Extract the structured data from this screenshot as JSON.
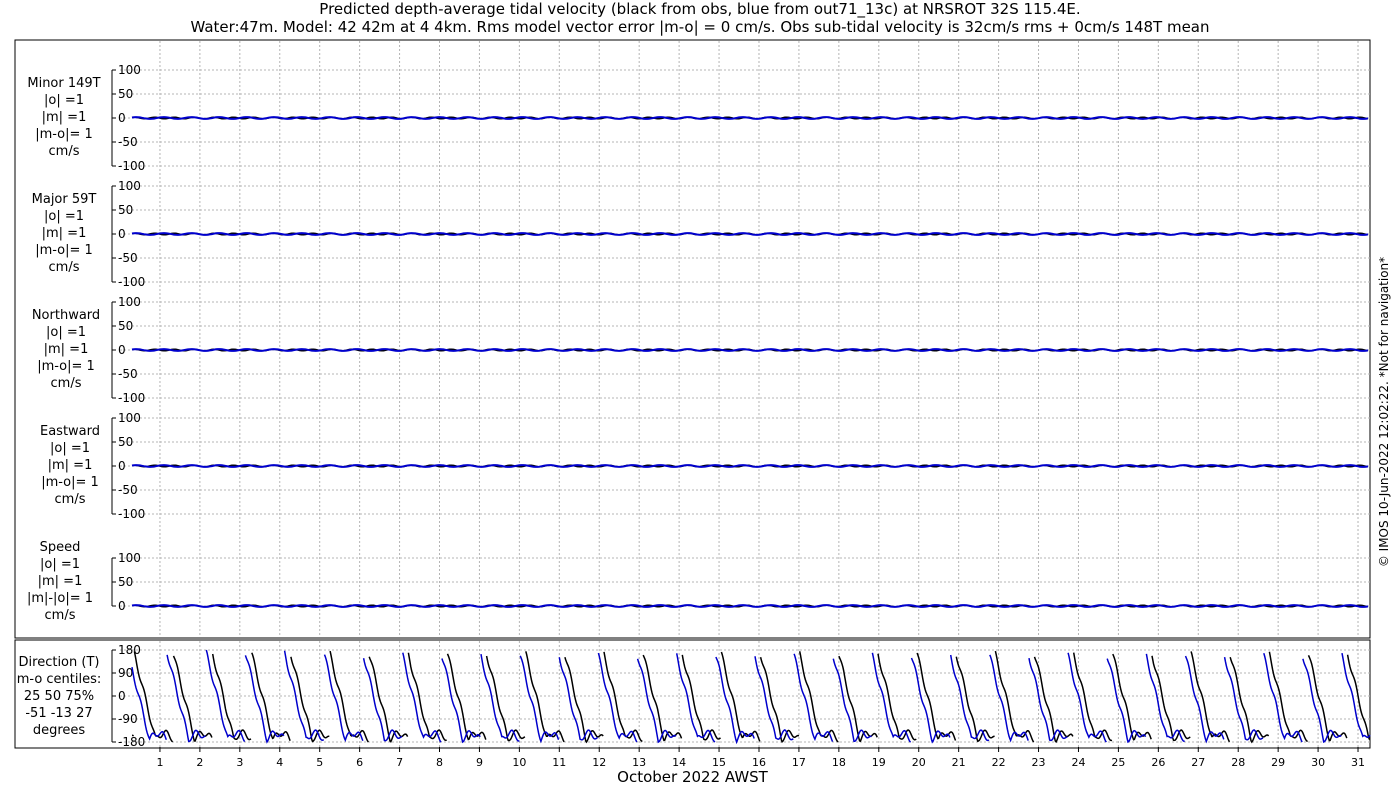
{
  "title": {
    "line1": "Predicted depth-average tidal velocity (black from obs, blue from out71_13c) at NRSROT 32S 115.4E.",
    "line2": "Water:47m. Model: 42 42m at 4 4km. Rms model vector error |m-o| = 0 cm/s. Obs sub-tidal velocity is 32cm/s rms + 0cm/s 148T mean"
  },
  "xlabel": "October 2022 AWST",
  "credit": "© IMOS 10-Jun-2022 12:02:22. *Not for navigation*",
  "panels": [
    {
      "lines": [
        "Minor 149T",
        "|o| =1",
        "|m| =1",
        "|m-o|= 1",
        "cm/s"
      ]
    },
    {
      "lines": [
        "Major 59T",
        "|o| =1",
        "|m| =1",
        "|m-o|= 1",
        "cm/s"
      ]
    },
    {
      "lines": [
        "Northward",
        "|o| =1",
        "|m| =1",
        "|m-o|= 1",
        "cm/s"
      ]
    },
    {
      "lines": [
        "Eastward",
        "|o| =1",
        "|m| =1",
        "|m-o|= 1",
        "cm/s"
      ]
    },
    {
      "lines": [
        "Speed",
        "|o| =1",
        "|m| =1",
        "|m|-|o|= 1",
        "cm/s"
      ]
    },
    {
      "lines": [
        "Direction (T)",
        "m-o centiles:",
        "25  50  75%",
        "-51 -13  27",
        "degrees"
      ]
    }
  ],
  "chart_data": {
    "type": "line",
    "x_range_days": [
      0.3,
      31.3
    ],
    "x_ticks": [
      "1",
      "2",
      "3",
      "4",
      "5",
      "6",
      "7",
      "8",
      "9",
      "10",
      "11",
      "12",
      "13",
      "14",
      "15",
      "16",
      "17",
      "18",
      "19",
      "20",
      "21",
      "22",
      "23",
      "24",
      "25",
      "26",
      "27",
      "28",
      "29",
      "30",
      "31"
    ],
    "colors": {
      "obs": "#000000",
      "model": "#0000cc",
      "grid": "#b4b4b4"
    },
    "series_names": [
      "obs",
      "model"
    ],
    "velocity_panels": [
      {
        "ylim": [
          -100,
          100
        ],
        "ticks": [
          "100",
          "50",
          "0",
          "-50",
          "-100"
        ],
        "obs_value": 0,
        "model_value": 0
      },
      {
        "ylim": [
          -100,
          100
        ],
        "ticks": [
          "100",
          "50",
          "0",
          "-50",
          "-100"
        ],
        "obs_value": 0,
        "model_value": 0
      },
      {
        "ylim": [
          -100,
          100
        ],
        "ticks": [
          "100",
          "50",
          "0",
          "-50",
          "-100"
        ],
        "obs_value": 0,
        "model_value": 0
      },
      {
        "ylim": [
          -100,
          100
        ],
        "ticks": [
          "100",
          "50",
          "0",
          "-50",
          "-100"
        ],
        "obs_value": 0,
        "model_value": 0
      },
      {
        "ylim": [
          0,
          100
        ],
        "ticks": [
          "100",
          "50",
          "0"
        ],
        "obs_value": 0,
        "model_value": 0
      }
    ],
    "direction_panel": {
      "ylim": [
        -180,
        180
      ],
      "ticks": [
        "180",
        "90",
        "0",
        "-90",
        "-180"
      ],
      "cycle_days": 0.98,
      "obs_phase_days": 0.35,
      "model_phase_days": 0.2
    }
  }
}
